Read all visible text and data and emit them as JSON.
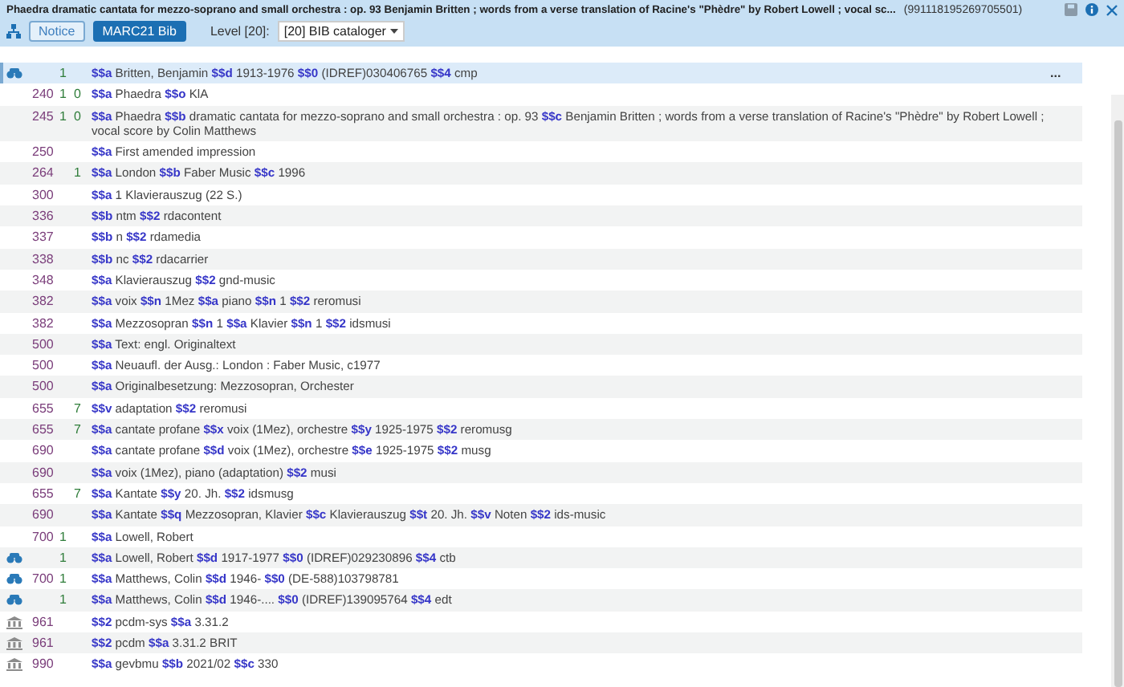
{
  "window": {
    "title": "Phaedra dramatic cantata for mezzo-soprano and small orchestra : op. 93 Benjamin Britten ; words from a verse translation of Racine's \"Phèdre\" by Robert Lowell ; vocal sc...",
    "record_id": "(991118195269705501)"
  },
  "toolbar": {
    "tabs": [
      {
        "label": "Notice",
        "selected": false
      },
      {
        "label": "MARC21 Bib",
        "selected": true
      }
    ],
    "level_label": "Level [20]:",
    "level_select": "[20] BIB cataloger"
  },
  "rows": [
    {
      "kind": "linked",
      "tag": "",
      "ind1": "1",
      "ind2": "",
      "selected": true,
      "more": "...",
      "subfields": [
        {
          "code": "$$a",
          "value": "Britten, Benjamin"
        },
        {
          "code": "$$d",
          "value": "1913-1976"
        },
        {
          "code": "$$0",
          "value": "(IDREF)030406765"
        },
        {
          "code": "$$4",
          "value": "cmp"
        }
      ]
    },
    {
      "kind": "plain",
      "tag": "240",
      "ind1": "1",
      "ind2": "0",
      "selected": false,
      "subfields": [
        {
          "code": "$$a",
          "value": "Phaedra"
        },
        {
          "code": "$$o",
          "value": "KlA"
        }
      ]
    },
    {
      "kind": "plain",
      "tag": "245",
      "ind1": "1",
      "ind2": "0",
      "selected": false,
      "subfields": [
        {
          "code": "$$a",
          "value": "Phaedra"
        },
        {
          "code": "$$b",
          "value": "dramatic cantata for mezzo-soprano and small orchestra : op. 93"
        },
        {
          "code": "$$c",
          "value": "Benjamin Britten ; words from a verse translation of Racine's \"Phèdre\" by Robert Lowell ; vocal score by Colin Matthews"
        }
      ]
    },
    {
      "kind": "plain",
      "tag": "250",
      "ind1": "",
      "ind2": "",
      "selected": false,
      "subfields": [
        {
          "code": "$$a",
          "value": "First amended impression"
        }
      ]
    },
    {
      "kind": "plain",
      "tag": "264",
      "ind1": "",
      "ind2": "1",
      "selected": false,
      "subfields": [
        {
          "code": "$$a",
          "value": "London"
        },
        {
          "code": "$$b",
          "value": "Faber Music"
        },
        {
          "code": "$$c",
          "value": "1996"
        }
      ]
    },
    {
      "kind": "plain",
      "tag": "300",
      "ind1": "",
      "ind2": "",
      "selected": false,
      "subfields": [
        {
          "code": "$$a",
          "value": "1 Klavierauszug (22 S.)"
        }
      ]
    },
    {
      "kind": "plain",
      "tag": "336",
      "ind1": "",
      "ind2": "",
      "selected": false,
      "subfields": [
        {
          "code": "$$b",
          "value": "ntm"
        },
        {
          "code": "$$2",
          "value": "rdacontent"
        }
      ]
    },
    {
      "kind": "plain",
      "tag": "337",
      "ind1": "",
      "ind2": "",
      "selected": false,
      "subfields": [
        {
          "code": "$$b",
          "value": "n"
        },
        {
          "code": "$$2",
          "value": "rdamedia"
        }
      ]
    },
    {
      "kind": "plain",
      "tag": "338",
      "ind1": "",
      "ind2": "",
      "selected": false,
      "subfields": [
        {
          "code": "$$b",
          "value": "nc"
        },
        {
          "code": "$$2",
          "value": "rdacarrier"
        }
      ]
    },
    {
      "kind": "plain",
      "tag": "348",
      "ind1": "",
      "ind2": "",
      "selected": false,
      "subfields": [
        {
          "code": "$$a",
          "value": "Klavierauszug"
        },
        {
          "code": "$$2",
          "value": "gnd-music"
        }
      ]
    },
    {
      "kind": "plain",
      "tag": "382",
      "ind1": "",
      "ind2": "",
      "selected": false,
      "subfields": [
        {
          "code": "$$a",
          "value": "voix"
        },
        {
          "code": "$$n",
          "value": "1Mez"
        },
        {
          "code": "$$a",
          "value": "piano"
        },
        {
          "code": "$$n",
          "value": "1"
        },
        {
          "code": "$$2",
          "value": "reromusi"
        }
      ]
    },
    {
      "kind": "plain",
      "tag": "382",
      "ind1": "",
      "ind2": "",
      "selected": false,
      "subfields": [
        {
          "code": "$$a",
          "value": "Mezzosopran"
        },
        {
          "code": "$$n",
          "value": "1"
        },
        {
          "code": "$$a",
          "value": "Klavier"
        },
        {
          "code": "$$n",
          "value": "1"
        },
        {
          "code": "$$2",
          "value": "idsmusi"
        }
      ]
    },
    {
      "kind": "plain",
      "tag": "500",
      "ind1": "",
      "ind2": "",
      "selected": false,
      "subfields": [
        {
          "code": "$$a",
          "value": "Text: engl. Originaltext"
        }
      ]
    },
    {
      "kind": "plain",
      "tag": "500",
      "ind1": "",
      "ind2": "",
      "selected": false,
      "subfields": [
        {
          "code": "$$a",
          "value": "Neuaufl. der Ausg.: London : Faber Music, c1977"
        }
      ]
    },
    {
      "kind": "plain",
      "tag": "500",
      "ind1": "",
      "ind2": "",
      "selected": false,
      "subfields": [
        {
          "code": "$$a",
          "value": "Originalbesetzung: Mezzosopran, Orchester"
        }
      ]
    },
    {
      "kind": "plain",
      "tag": "655",
      "ind1": "",
      "ind2": "7",
      "selected": false,
      "subfields": [
        {
          "code": "$$v",
          "value": "adaptation"
        },
        {
          "code": "$$2",
          "value": "reromusi"
        }
      ]
    },
    {
      "kind": "plain",
      "tag": "655",
      "ind1": "",
      "ind2": "7",
      "selected": false,
      "subfields": [
        {
          "code": "$$a",
          "value": "cantate profane"
        },
        {
          "code": "$$x",
          "value": "voix (1Mez), orchestre"
        },
        {
          "code": "$$y",
          "value": "1925-1975"
        },
        {
          "code": "$$2",
          "value": "reromusg"
        }
      ]
    },
    {
      "kind": "plain",
      "tag": "690",
      "ind1": "",
      "ind2": "",
      "selected": false,
      "subfields": [
        {
          "code": "$$a",
          "value": "cantate profane"
        },
        {
          "code": "$$d",
          "value": "voix (1Mez),  orchestre"
        },
        {
          "code": "$$e",
          "value": "1925-1975"
        },
        {
          "code": "$$2",
          "value": "musg"
        }
      ]
    },
    {
      "kind": "plain",
      "tag": "690",
      "ind1": "",
      "ind2": "",
      "selected": false,
      "subfields": [
        {
          "code": "$$a",
          "value": "voix (1Mez), piano (adaptation)"
        },
        {
          "code": "$$2",
          "value": "musi"
        }
      ]
    },
    {
      "kind": "plain",
      "tag": "655",
      "ind1": "",
      "ind2": "7",
      "selected": false,
      "subfields": [
        {
          "code": "$$a",
          "value": "Kantate"
        },
        {
          "code": "$$y",
          "value": "20. Jh."
        },
        {
          "code": "$$2",
          "value": "idsmusg"
        }
      ]
    },
    {
      "kind": "plain",
      "tag": "690",
      "ind1": "",
      "ind2": "",
      "selected": false,
      "subfields": [
        {
          "code": "$$a",
          "value": "Kantate"
        },
        {
          "code": "$$q",
          "value": "Mezzosopran, Klavier"
        },
        {
          "code": "$$c",
          "value": "Klavierauszug"
        },
        {
          "code": "$$t",
          "value": "20. Jh."
        },
        {
          "code": "$$v",
          "value": "Noten"
        },
        {
          "code": "$$2",
          "value": "ids-music"
        }
      ]
    },
    {
      "kind": "plain",
      "tag": "700",
      "ind1": "1",
      "ind2": "",
      "selected": false,
      "subfields": [
        {
          "code": "$$a",
          "value": "Lowell, Robert"
        }
      ]
    },
    {
      "kind": "linked",
      "tag": "",
      "ind1": "1",
      "ind2": "",
      "selected": false,
      "subfields": [
        {
          "code": "$$a",
          "value": "Lowell, Robert"
        },
        {
          "code": "$$d",
          "value": "1917-1977"
        },
        {
          "code": "$$0",
          "value": "(IDREF)029230896"
        },
        {
          "code": "$$4",
          "value": "ctb"
        }
      ]
    },
    {
      "kind": "linked",
      "tag": "700",
      "ind1": "1",
      "ind2": "",
      "selected": false,
      "subfields": [
        {
          "code": "$$a",
          "value": "Matthews, Colin"
        },
        {
          "code": "$$d",
          "value": "1946-"
        },
        {
          "code": "$$0",
          "value": "(DE-588)103798781"
        }
      ]
    },
    {
      "kind": "linked",
      "tag": "",
      "ind1": "1",
      "ind2": "",
      "selected": false,
      "subfields": [
        {
          "code": "$$a",
          "value": "Matthews, Colin"
        },
        {
          "code": "$$d",
          "value": "1946-...."
        },
        {
          "code": "$$0",
          "value": "(IDREF)139095764"
        },
        {
          "code": "$$4",
          "value": "edt"
        }
      ]
    },
    {
      "kind": "local",
      "tag": "961",
      "ind1": "",
      "ind2": "",
      "selected": false,
      "subfields": [
        {
          "code": "$$2",
          "value": "pcdm-sys"
        },
        {
          "code": "$$a",
          "value": "3.31.2"
        }
      ]
    },
    {
      "kind": "local",
      "tag": "961",
      "ind1": "",
      "ind2": "",
      "selected": false,
      "subfields": [
        {
          "code": "$$2",
          "value": "pcdm"
        },
        {
          "code": "$$a",
          "value": "3.31.2 BRIT"
        }
      ]
    },
    {
      "kind": "local",
      "tag": "990",
      "ind1": "",
      "ind2": "",
      "selected": false,
      "subfields": [
        {
          "code": "$$a",
          "value": "gevbmu"
        },
        {
          "code": "$$b",
          "value": "2021/02"
        },
        {
          "code": "$$c",
          "value": "330"
        }
      ]
    }
  ]
}
